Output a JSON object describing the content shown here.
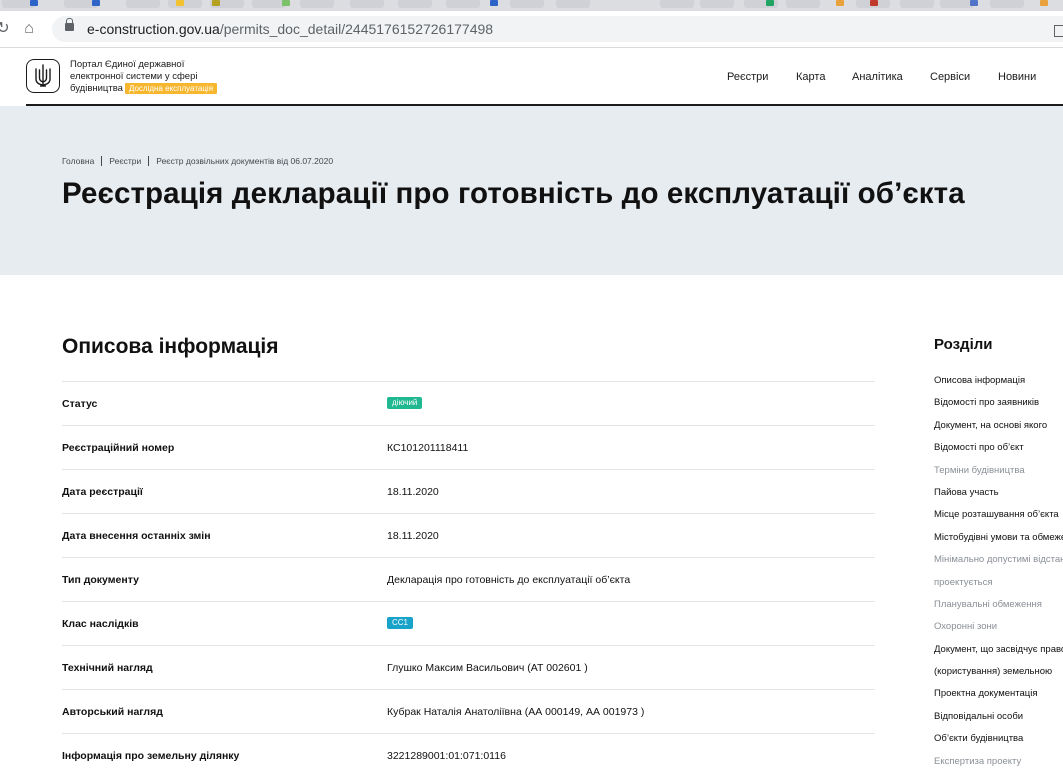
{
  "browser": {
    "url_host": "e-construction.gov.ua",
    "url_path": "/permits_doc_detail/2445176152726177498"
  },
  "header": {
    "portal_line1": "Портал Єдиної державної",
    "portal_line2": "електронної системи у сфері",
    "portal_line3": "будівництва",
    "trial_badge": "Дослідна експлуатація",
    "nav": [
      "Реєстри",
      "Карта",
      "Аналітика",
      "Сервіси",
      "Новини"
    ]
  },
  "breadcrumb": [
    "Головна",
    "Реєстри",
    "Реєстр дозвільних документів від 06.07.2020"
  ],
  "page_title": "Реєстрація декларації про готовність до експлуатації об’єкта",
  "section_title": "Описова інформація",
  "rows": [
    {
      "label": "Статус",
      "value": "діючий",
      "chip": "green"
    },
    {
      "label": "Реєстраційний номер",
      "value": "КС101201118411"
    },
    {
      "label": "Дата реєстрації",
      "value": "18.11.2020"
    },
    {
      "label": "Дата внесення останніх змін",
      "value": "18.11.2020"
    },
    {
      "label": "Тип документу",
      "value": "Декларація про готовність до експлуатації об’єкта"
    },
    {
      "label": "Клас наслідків",
      "value": "СС1",
      "chip": "teal"
    },
    {
      "label": "Технічний нагляд",
      "value": "Глушко Максим Васильович (АТ 002601 )"
    },
    {
      "label": "Авторський нагляд",
      "value": "Кубрак Наталія Анатоліївна (АА 000149, АА 001973 )"
    },
    {
      "label": "Інформація про земельну ділянку",
      "value": "3221289001:01:071:0116"
    }
  ],
  "sidebar": {
    "title": "Розділи",
    "items": [
      {
        "label": "Описова інформація",
        "muted": false
      },
      {
        "label": "Відомості про заявників",
        "muted": false
      },
      {
        "label": "Документ, на основі якого",
        "muted": false
      },
      {
        "label": "Відомості про об’єкт",
        "muted": false
      },
      {
        "label": "Терміни будівництва",
        "muted": true
      },
      {
        "label": "Пайова участь",
        "muted": false
      },
      {
        "label": "Місце розташування об’єкта",
        "muted": false
      },
      {
        "label": "Містобудівні умови та обмеження",
        "muted": false
      },
      {
        "label": "Мінімально допустимі відстані",
        "muted": true
      },
      {
        "label": "проектується",
        "muted": true
      },
      {
        "label": "Планувальні обмеження",
        "muted": true
      },
      {
        "label": "Охоронні зони",
        "muted": true
      },
      {
        "label": "Документ, що засвідчує право",
        "muted": false
      },
      {
        "label": "(користування) земельною",
        "muted": false
      },
      {
        "label": "Проектна документація",
        "muted": false
      },
      {
        "label": "Відповідальні особи",
        "muted": false
      },
      {
        "label": "Об’єкти будівництва",
        "muted": false
      },
      {
        "label": "Експертиза проекту",
        "muted": true
      }
    ]
  },
  "colors": {
    "status_chip": "#1fb890",
    "class_chip": "#1aa3c9",
    "trial_badge": "#f6b62e",
    "banner": "#e7ecf0"
  }
}
